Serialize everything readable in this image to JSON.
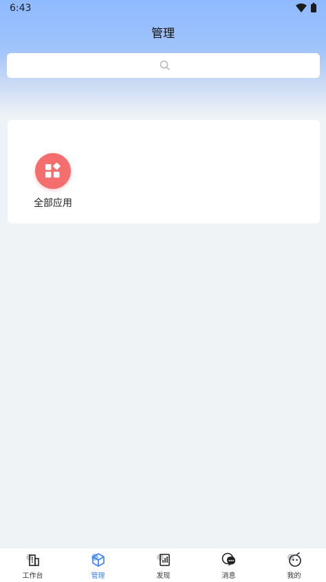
{
  "status_bar": {
    "time": "6:43",
    "wifi_icon": "wifi-icon",
    "battery_icon": "battery-icon"
  },
  "header": {
    "title": "管理"
  },
  "search": {
    "placeholder": "",
    "icon": "search-icon"
  },
  "apps": [
    {
      "label": "全部应用",
      "icon": "grid-apps-icon",
      "color": "#f56e6e"
    }
  ],
  "tab_bar": {
    "active_color": "#3b82f6",
    "items": [
      {
        "label": "工作台",
        "icon": "building-icon",
        "active": false
      },
      {
        "label": "管理",
        "icon": "cube-icon",
        "active": true
      },
      {
        "label": "发现",
        "icon": "document-chart-icon",
        "active": false
      },
      {
        "label": "消息",
        "icon": "chat-bubble-icon",
        "active": false
      },
      {
        "label": "我的",
        "icon": "smiley-face-icon",
        "active": false
      }
    ]
  }
}
